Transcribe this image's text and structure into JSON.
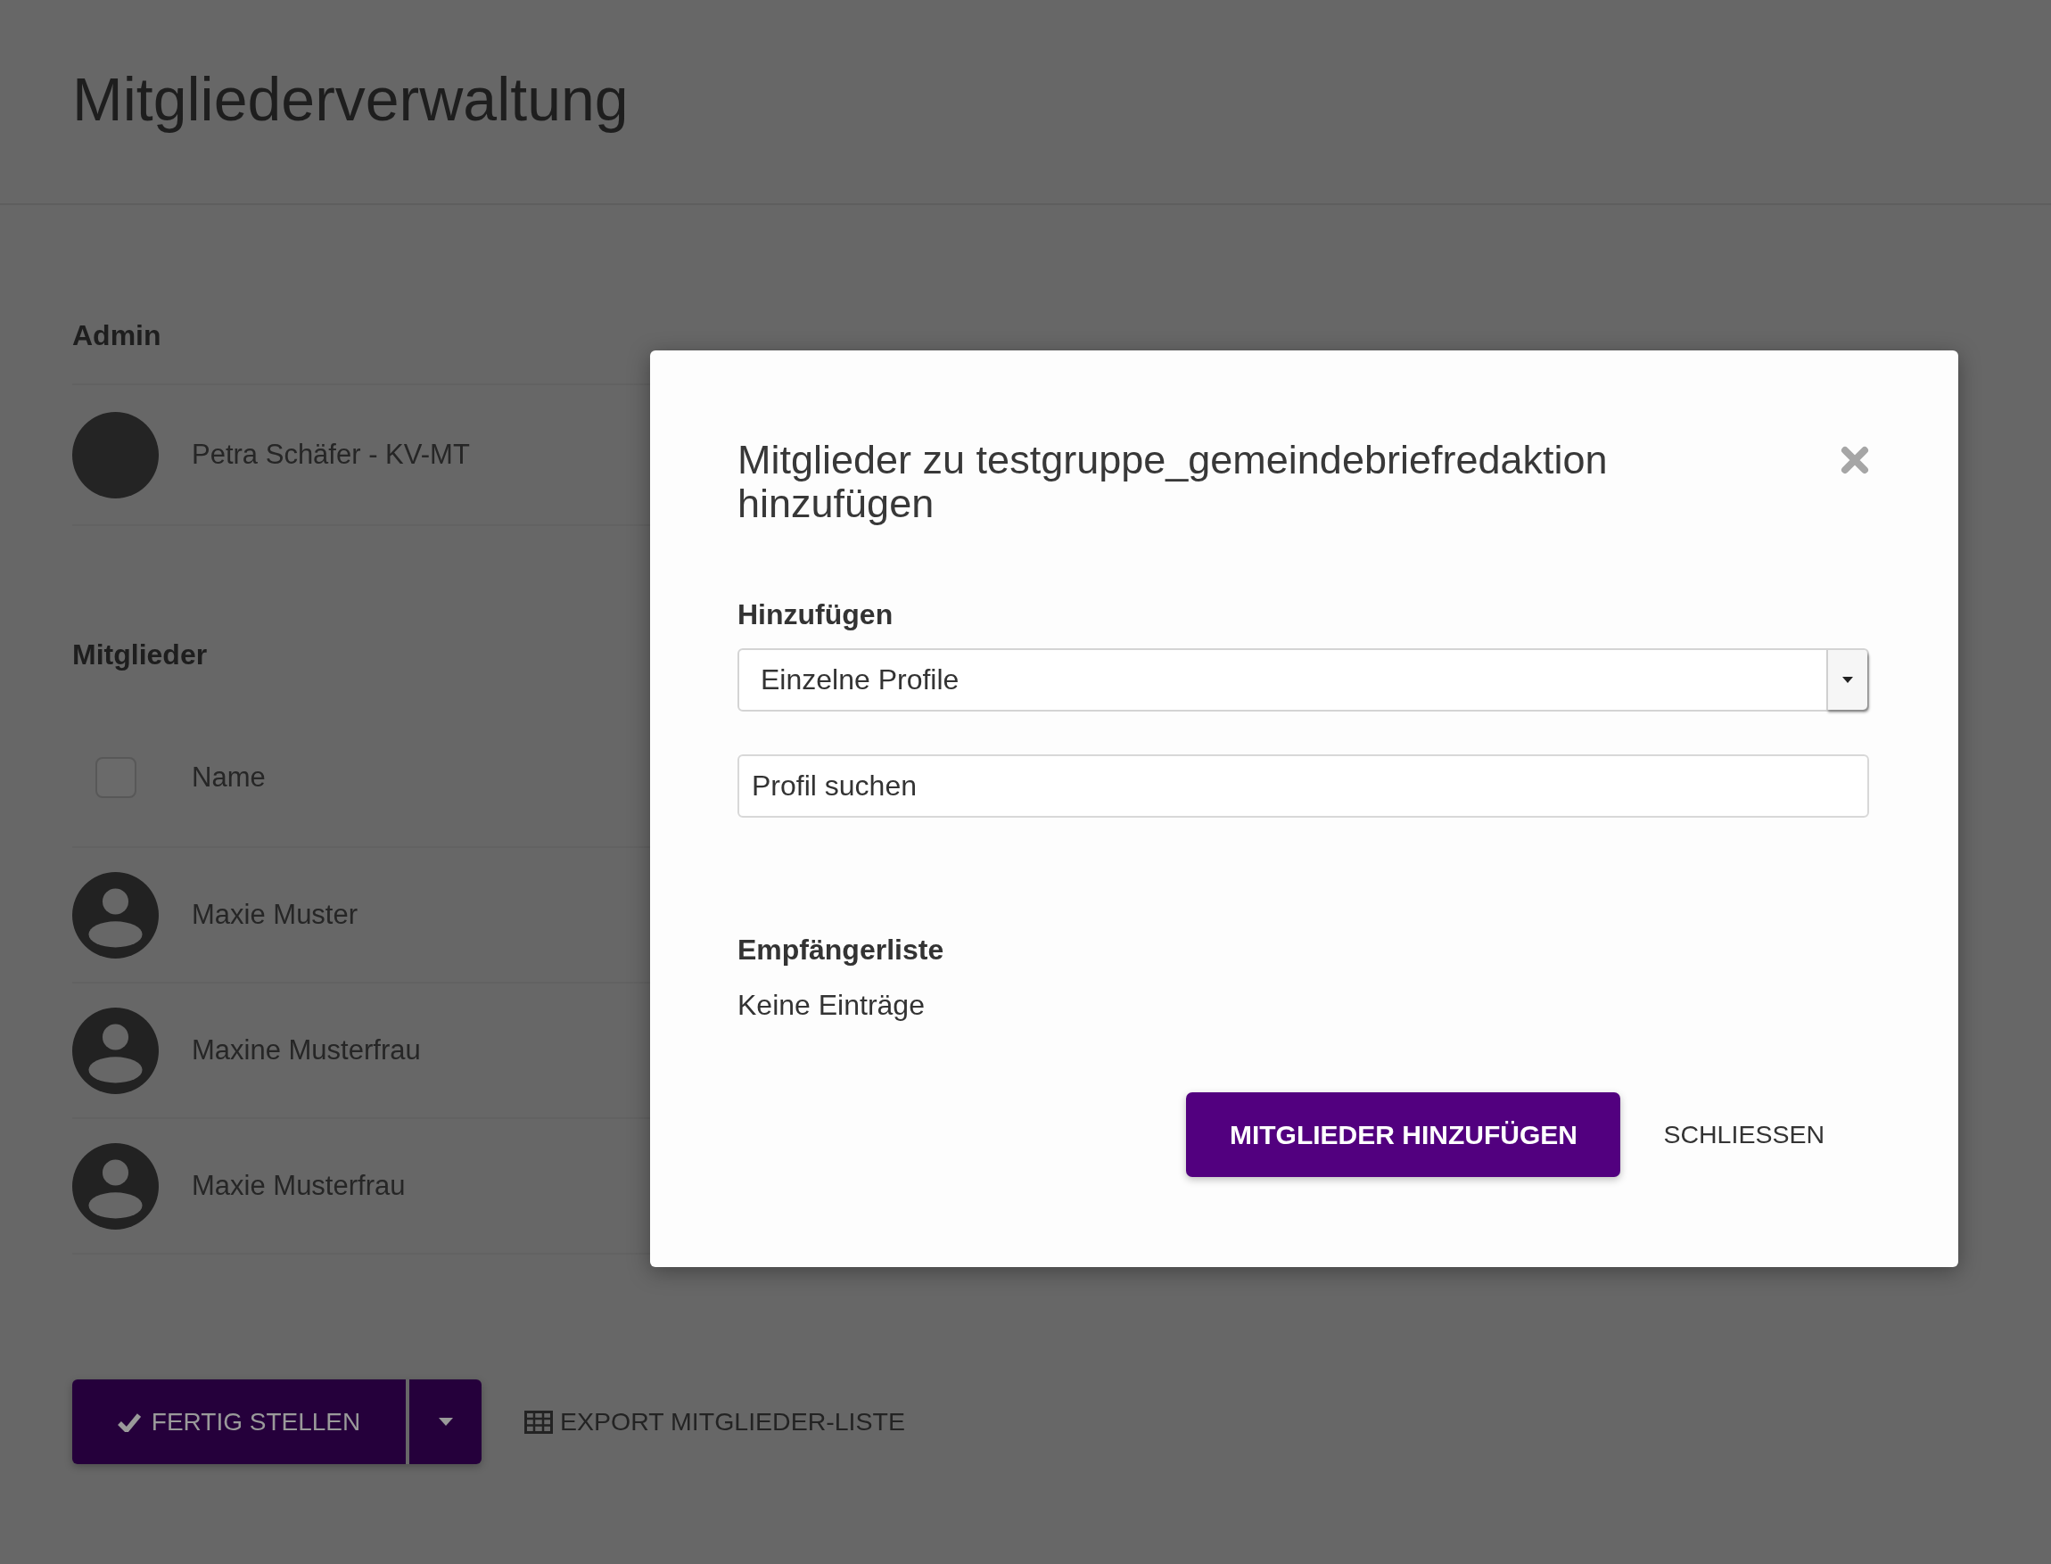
{
  "page": {
    "title": "Mitgliederverwaltung"
  },
  "admin_section": {
    "heading": "Admin",
    "members": [
      {
        "name": "Petra Schäfer - KV-MT",
        "kind": "photo"
      }
    ]
  },
  "members_section": {
    "heading": "Mitglieder",
    "select_all": {
      "label": "Name",
      "checked": false
    },
    "members": [
      {
        "name": "Maxie Muster",
        "kind": "default"
      },
      {
        "name": "Maxine Musterfrau",
        "kind": "default"
      },
      {
        "name": "Maxie Musterfrau",
        "kind": "default"
      }
    ]
  },
  "actions": {
    "finish_button": {
      "label": "FERTIG STELLEN"
    },
    "export_link": {
      "label": "EXPORT MITGLIEDER-LISTE"
    }
  },
  "dialog": {
    "title": "Mitglieder zu testgruppe_gemeindebriefredaktion hinzufügen",
    "add_label": "Hinzufügen",
    "add_select": {
      "value": "Einzelne Profile"
    },
    "search": {
      "placeholder": "Profil suchen"
    },
    "recipients_heading": "Empfängerliste",
    "recipients_empty": "Keine Einträge",
    "buttons": [
      {
        "label": "MITGLIEDER HINZUFÜGEN",
        "kind": "primary"
      },
      {
        "label": "SCHLIESSEN",
        "kind": "text"
      }
    ]
  }
}
